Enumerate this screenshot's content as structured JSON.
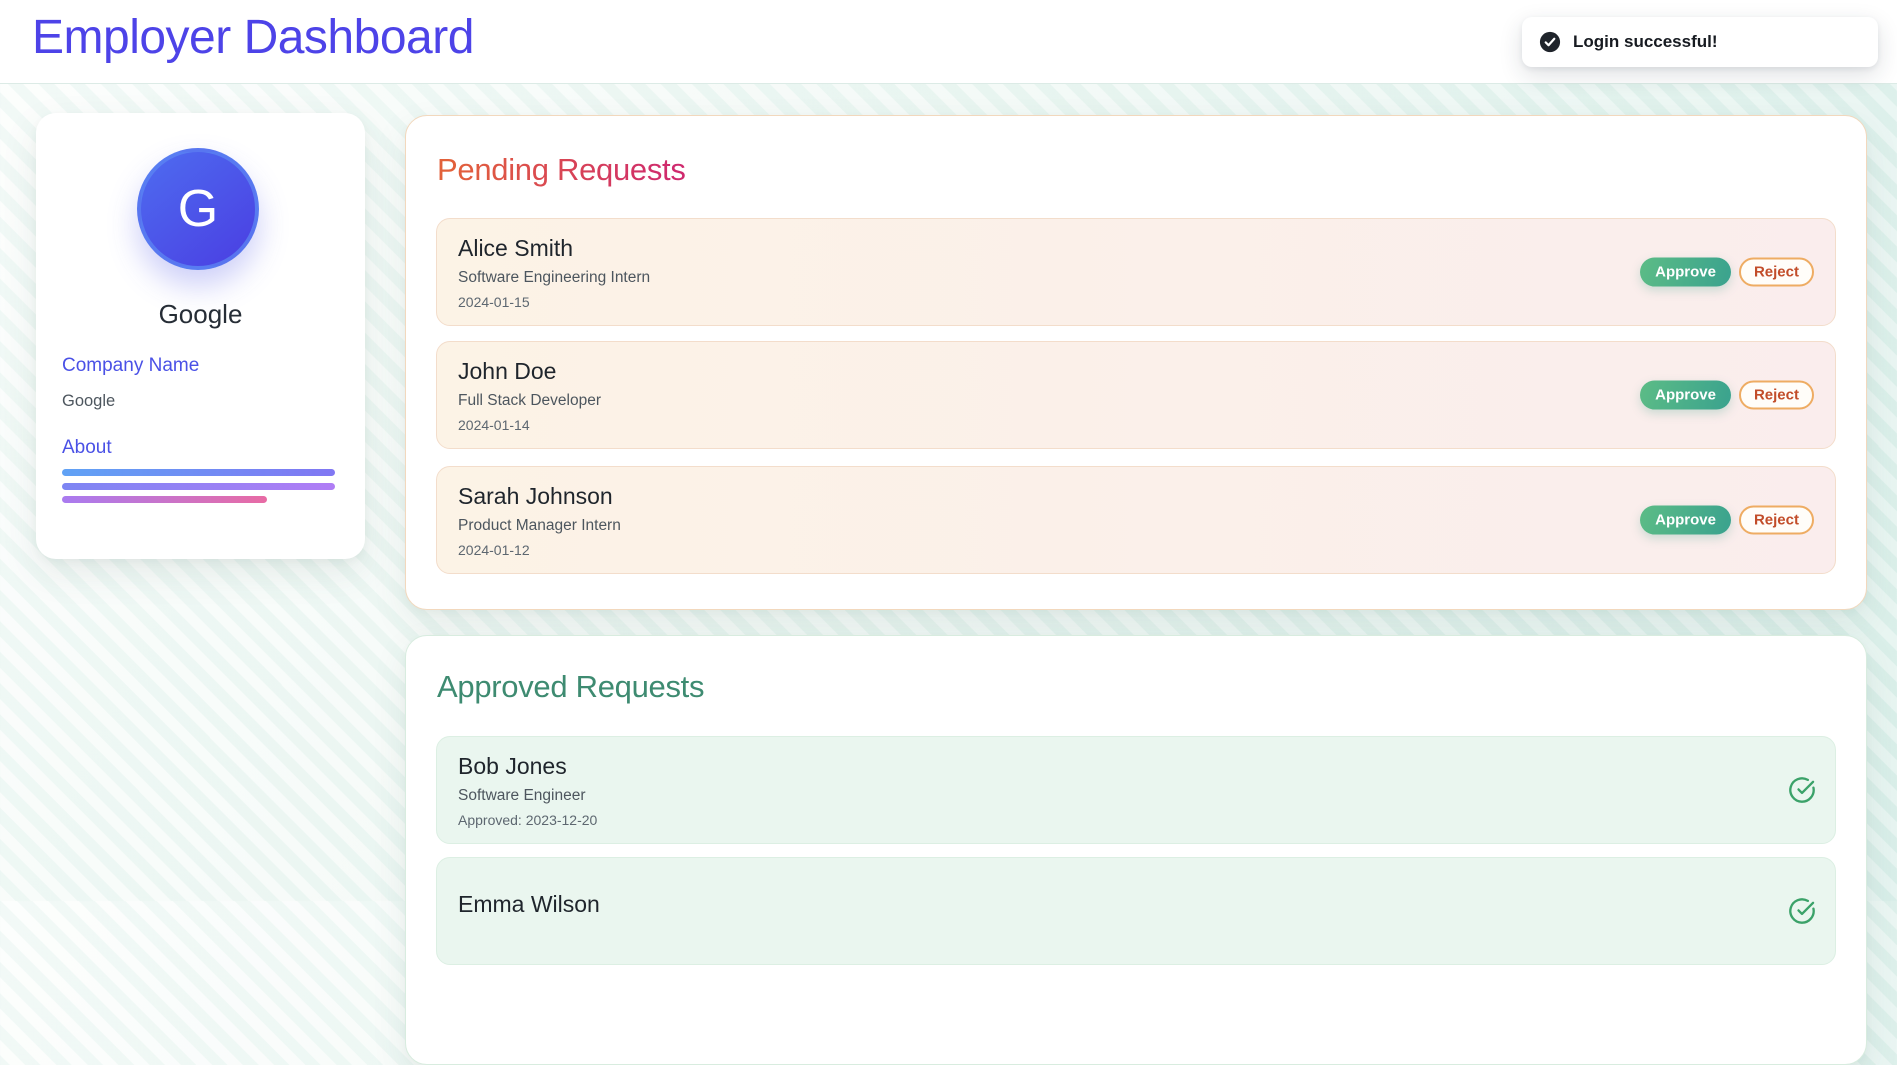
{
  "header": {
    "title": "Employer Dashboard"
  },
  "toast": {
    "message": "Login successful!",
    "icon": "check-circle-icon"
  },
  "sidebar": {
    "avatar_letter": "G",
    "company_title": "Google",
    "fields": [
      {
        "label": "Company Name",
        "value": "Google"
      },
      {
        "label": "About"
      }
    ],
    "about_skeleton_bars": 3
  },
  "pending": {
    "heading": "Pending Requests",
    "approve_label": "Approve",
    "reject_label": "Reject",
    "items": [
      {
        "name": "Alice Smith",
        "role": "Software Engineering Intern",
        "date": "2024-01-15"
      },
      {
        "name": "John Doe",
        "role": "Full Stack Developer",
        "date": "2024-01-14"
      },
      {
        "name": "Sarah Johnson",
        "role": "Product Manager Intern",
        "date": "2024-01-12"
      }
    ]
  },
  "approved": {
    "heading": "Approved Requests",
    "items": [
      {
        "name": "Bob Jones",
        "role": "Software Engineer",
        "date": "Approved: 2023-12-20"
      },
      {
        "name": "Emma Wilson"
      }
    ]
  },
  "colors": {
    "accent": "#4d43e8",
    "pending_heading_gradient_start": "#e2613a",
    "pending_heading_gradient_end": "#cf2a6e",
    "approved_heading": "#3e8b71",
    "approve_button_gradient_start": "#5cbc86",
    "approve_button_gradient_end": "#3aa28e",
    "reject_border": "#eeac63",
    "reject_text": "#c24d2a",
    "check_icon_green": "#3ba269",
    "toast_icon_bg": "#1f242b"
  }
}
